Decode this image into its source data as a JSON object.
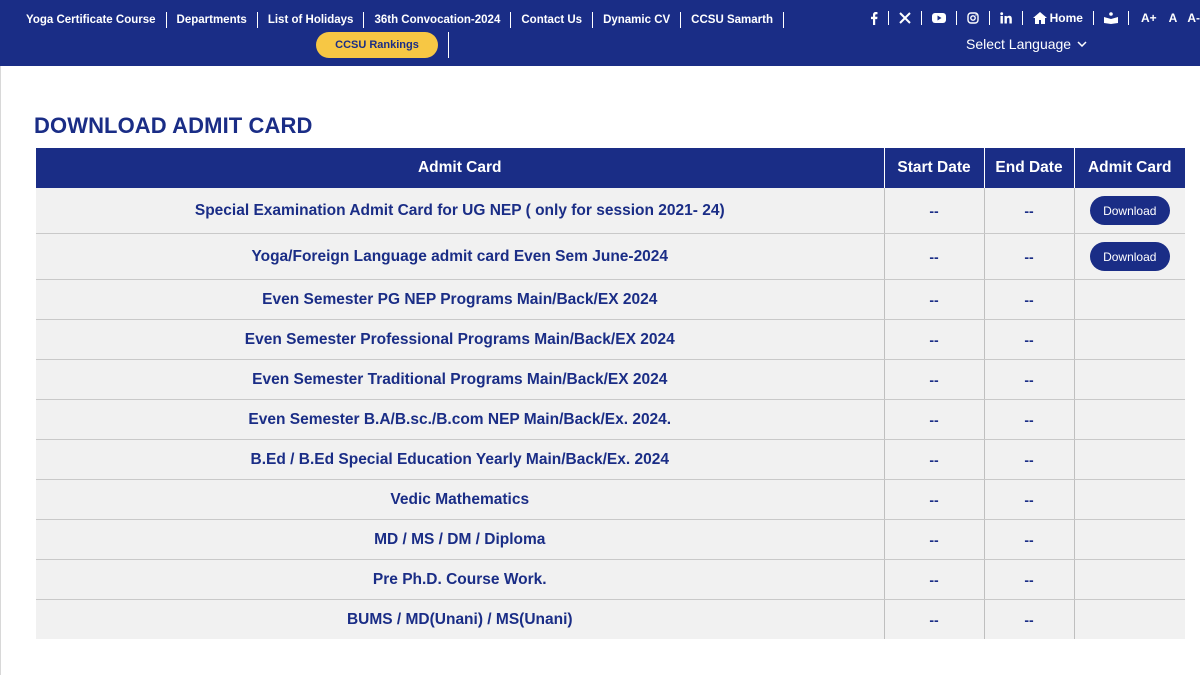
{
  "nav": {
    "items": [
      "Yoga Certificate Course",
      "Departments",
      "List of Holidays",
      "36th Convocation-2024",
      "Contact Us",
      "Dynamic CV",
      "CCSU Samarth"
    ],
    "rankings_label": "CCSU Rankings"
  },
  "social": {
    "icons": [
      "facebook-icon",
      "x-twitter-icon",
      "youtube-icon",
      "instagram-icon",
      "linkedin-icon"
    ],
    "home_label": "Home",
    "font_increase": "A+",
    "font_normal": "A",
    "font_decrease": "A-"
  },
  "language": {
    "label": "Select Language"
  },
  "page": {
    "title": "DOWNLOAD ADMIT CARD"
  },
  "table": {
    "headers": [
      "Admit Card",
      "Start Date",
      "End Date",
      "Admit Card"
    ],
    "download_label": "Download",
    "rows": [
      {
        "name": "Special Examination Admit Card for UG NEP ( only for session 2021- 24)",
        "start": "--",
        "end": "--",
        "download": true
      },
      {
        "name": "Yoga/Foreign Language admit card Even Sem June-2024",
        "start": "--",
        "end": "--",
        "download": true
      },
      {
        "name": "Even Semester PG NEP Programs Main/Back/EX 2024",
        "start": "--",
        "end": "--",
        "download": false
      },
      {
        "name": "Even Semester Professional Programs Main/Back/EX 2024",
        "start": "--",
        "end": "--",
        "download": false
      },
      {
        "name": "Even Semester Traditional Programs Main/Back/EX 2024",
        "start": "--",
        "end": "--",
        "download": false
      },
      {
        "name": "Even Semester B.A/B.sc./B.com NEP Main/Back/Ex. 2024.",
        "start": "--",
        "end": "--",
        "download": false
      },
      {
        "name": "B.Ed / B.Ed Special Education Yearly Main/Back/Ex. 2024",
        "start": "--",
        "end": "--",
        "download": false
      },
      {
        "name": "Vedic Mathematics",
        "start": "--",
        "end": "--",
        "download": false
      },
      {
        "name": "MD / MS / DM / Diploma",
        "start": "--",
        "end": "--",
        "download": false
      },
      {
        "name": "Pre Ph.D. Course Work.",
        "start": "--",
        "end": "--",
        "download": false
      },
      {
        "name": "BUMS / MD(Unani) / MS(Unani)",
        "start": "--",
        "end": "--",
        "download": false
      }
    ]
  },
  "colors": {
    "primary": "#1a2d86",
    "accent": "#f7c744",
    "row_bg": "#f1f1f1"
  }
}
